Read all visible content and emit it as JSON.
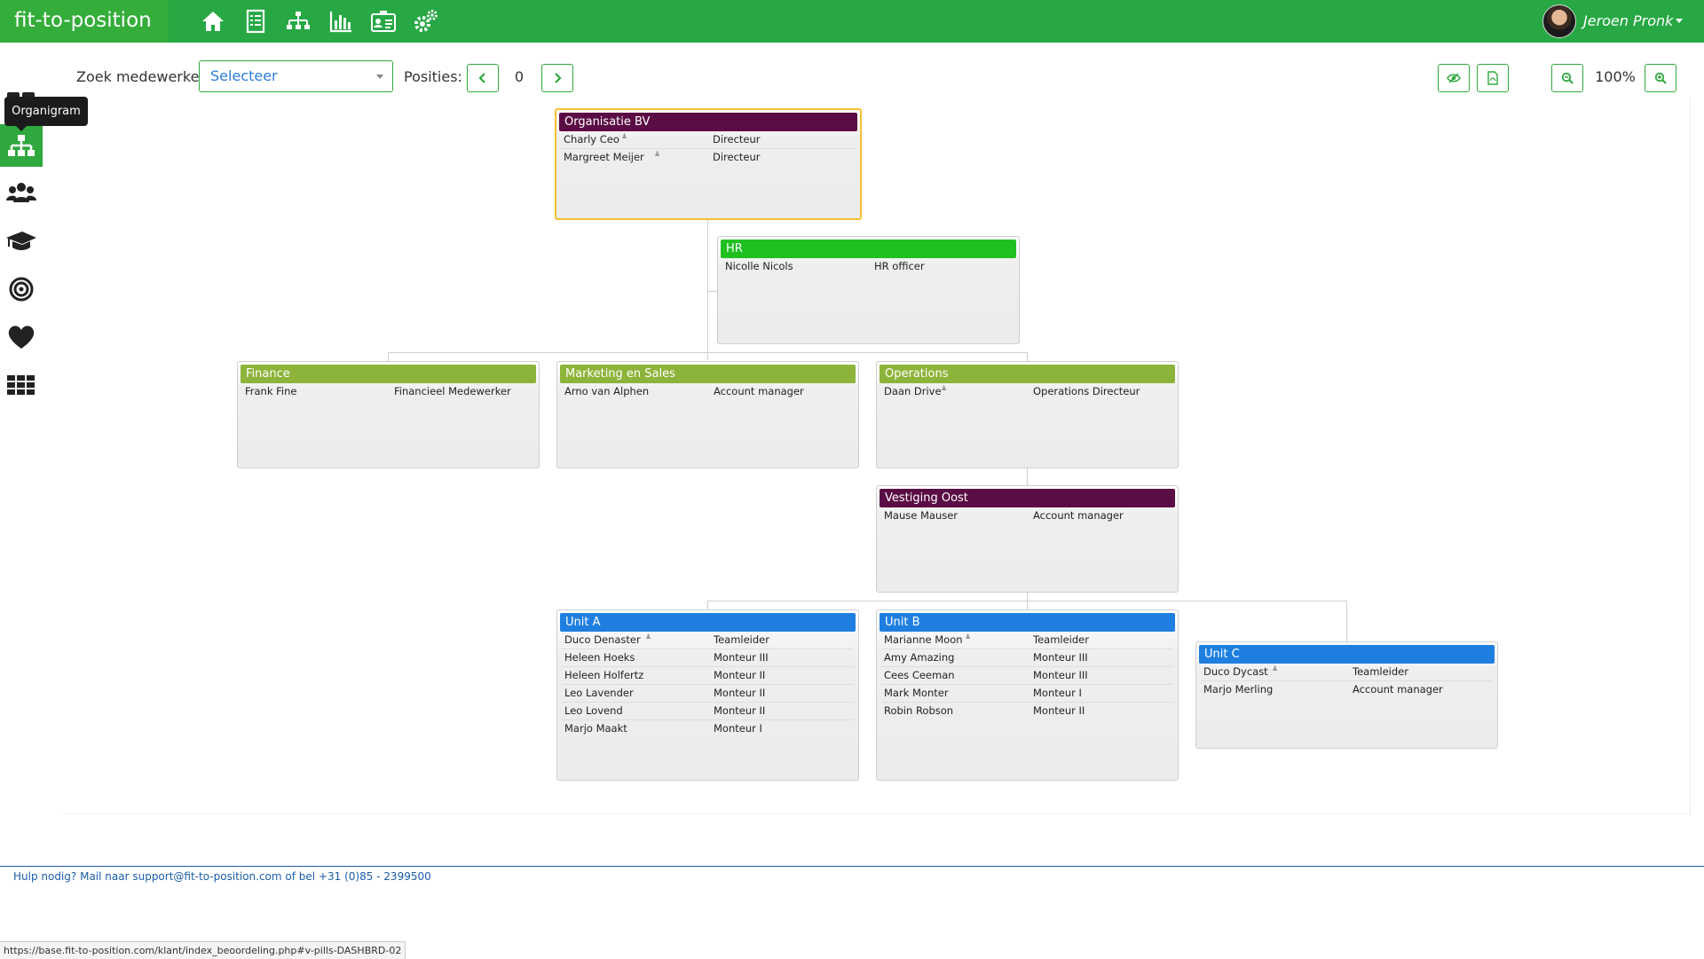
{
  "app": {
    "brand": "fit-to-position"
  },
  "user": {
    "name": "Jeroen Pronk"
  },
  "topnav": [
    {
      "icon": "home-icon"
    },
    {
      "icon": "checklist-icon"
    },
    {
      "icon": "org-chart-icon"
    },
    {
      "icon": "bar-chart-icon"
    },
    {
      "icon": "id-card-icon"
    },
    {
      "icon": "gears-icon"
    }
  ],
  "sidebar": {
    "tooltip": "Organigram",
    "items": [
      {
        "icon": "dashboard-icon"
      },
      {
        "icon": "org-chart-icon",
        "active": true
      },
      {
        "icon": "users-icon"
      },
      {
        "icon": "graduation-cap-icon"
      },
      {
        "icon": "target-icon"
      },
      {
        "icon": "heart-icon"
      },
      {
        "icon": "apps-grid-icon"
      }
    ]
  },
  "toolbar": {
    "search_label": "Zoek medewerker",
    "select_value": "Selecteer",
    "positions_label": "Posities:",
    "positions_count": "0",
    "zoom": "100%"
  },
  "colors": {
    "brand_green": "#27a844",
    "root": "#5a0d44",
    "hr": "#20c020",
    "department": "#8db43a",
    "unit": "#1e7fe0",
    "selected_border": "#f4c032"
  },
  "orgchart": {
    "root": {
      "title": "Organisatie BV",
      "rows": [
        {
          "name": "Charly Ceo",
          "manager": true,
          "position": "Directeur"
        },
        {
          "name": "Margreet Meijer",
          "manager": true,
          "position": "Directeur"
        }
      ]
    },
    "hr": {
      "title": "HR",
      "rows": [
        {
          "name": "Nicolle Nicols",
          "position": "HR officer"
        }
      ]
    },
    "finance": {
      "title": "Finance",
      "rows": [
        {
          "name": "Frank Fine",
          "position": "Financieel Medewerker"
        }
      ]
    },
    "marketing": {
      "title": "Marketing en Sales",
      "rows": [
        {
          "name": "Arno van Alphen",
          "position": "Account manager"
        }
      ]
    },
    "operations": {
      "title": "Operations",
      "rows": [
        {
          "name": "Daan Drive",
          "manager": true,
          "position": "Operations Directeur"
        }
      ]
    },
    "oost": {
      "title": "Vestiging Oost",
      "rows": [
        {
          "name": "Mause Mauser",
          "position": "Account manager"
        }
      ]
    },
    "unit_a": {
      "title": "Unit A",
      "rows": [
        {
          "name": "Duco Denaster",
          "manager": true,
          "position": "Teamleider"
        },
        {
          "name": "Heleen Hoeks",
          "position": "Monteur III"
        },
        {
          "name": "Heleen Holfertz",
          "position": "Monteur II"
        },
        {
          "name": "Leo Lavender",
          "position": "Monteur II"
        },
        {
          "name": "Leo Lovend",
          "position": "Monteur II"
        },
        {
          "name": "Marjo Maakt",
          "position": "Monteur I"
        }
      ]
    },
    "unit_b": {
      "title": "Unit B",
      "rows": [
        {
          "name": "Marianne Moon",
          "manager": true,
          "position": "Teamleider"
        },
        {
          "name": "Amy Amazing",
          "position": "Monteur III"
        },
        {
          "name": "Cees Ceeman",
          "position": "Monteur III"
        },
        {
          "name": "Mark Monter",
          "position": "Monteur I"
        },
        {
          "name": "Robin Robson",
          "position": "Monteur II"
        }
      ]
    },
    "unit_c": {
      "title": "Unit C",
      "rows": [
        {
          "name": "Duco Dycast",
          "manager": true,
          "position": "Teamleider"
        },
        {
          "name": "Marjo Merling",
          "position": "Account manager"
        }
      ]
    }
  },
  "footer": {
    "help_text": "Hulp nodig? Mail naar support@fit-to-position.com of bel +31 (0)85 - 2399500",
    "status_url": "https://base.fit-to-position.com/klant/index_beoordeling.php#v-pills-DASHBRD-02"
  }
}
